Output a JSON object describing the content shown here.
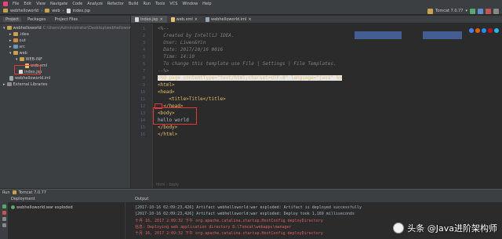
{
  "menubar": {
    "items": [
      "File",
      "Edit",
      "View",
      "Navigate",
      "Code",
      "Analyze",
      "Refactor",
      "Build",
      "Run",
      "Tools",
      "VCS",
      "Window",
      "Help"
    ]
  },
  "navbar": {
    "project": "webhelloworld",
    "folder": "web",
    "file": "index.jsp"
  },
  "run_config": {
    "label": "Tomcat 7.0.77"
  },
  "project_panel": {
    "tabs": [
      "Project",
      "Packages",
      "Project Files"
    ],
    "tree": [
      {
        "label": "webhelloworld",
        "path": "C:\\Users\\Administrator\\Desktop\\webhelloworld"
      },
      {
        "label": ".idea"
      },
      {
        "label": "out"
      },
      {
        "label": "src"
      },
      {
        "label": "web"
      },
      {
        "label": "WEB-INF"
      },
      {
        "label": "web.xml"
      },
      {
        "label": "index.jsp"
      },
      {
        "label": "webhelloworld.iml"
      },
      {
        "label": "External Libraries"
      }
    ]
  },
  "editor": {
    "tabs": [
      "index.jsp",
      "web.xml",
      "webhelloworld.iml"
    ],
    "active_tab": "index.jsp",
    "lines": [
      {
        "n": "1",
        "text": "<%--"
      },
      {
        "n": "2",
        "text": "  Created by IntelliJ IDEA."
      },
      {
        "n": "3",
        "text": "  User: Liwen&Yin"
      },
      {
        "n": "4",
        "text": "  Date: 2017/10/16 0016"
      },
      {
        "n": "5",
        "text": "  Time: 14:10"
      },
      {
        "n": "6",
        "text": "  To change this template use File | Settings | File Templates."
      },
      {
        "n": "7",
        "text": "--%>"
      },
      {
        "n": "8",
        "text": "<%@ page contentType=\"text/html;charset=UTF-8\" language=\"java\" %>"
      },
      {
        "n": "9",
        "text": "<html>"
      },
      {
        "n": "10",
        "text": "<head>"
      },
      {
        "n": "11",
        "text": "    <title>Title</title>"
      },
      {
        "n": "12",
        "text": "  </head>"
      },
      {
        "n": "13",
        "text": "<body>"
      },
      {
        "n": "14",
        "text": "hello world"
      },
      {
        "n": "15",
        "text": "</body>"
      },
      {
        "n": "16",
        "text": "</html>"
      }
    ],
    "breadcrumb": "html › body"
  },
  "run_panel": {
    "title": "Run",
    "config": "Tomcat 7.0.77",
    "deployment_label": "Deployment",
    "output_label": "Output",
    "deployment_item": "webhelloworld:war exploded",
    "output_lines": [
      {
        "text": "[2017-10-16 02:09:23,426] Artifact webhelloworld:war exploded: Artifact is deployed successfully",
        "color": "gray"
      },
      {
        "text": "[2017-10-16 02:09:23,426] Artifact webhelloworld:war exploded: Deploy took 1,169 milliseconds",
        "color": "gray"
      },
      {
        "text": "十月 16, 2017 2:09:32 下午 org.apache.catalina.startup.HostConfig deployDirectory",
        "color": "red"
      },
      {
        "text": "信息: Deploying web application directory D:\\Tomcat\\webapps\\manager",
        "color": "red"
      },
      {
        "text": "十月 16, 2017 2:09:32 下午 org.apache.catalina.startup.HostConfig deployDirectory",
        "color": "red"
      }
    ]
  },
  "watermark": {
    "text": "头条 @Java进阶架构师"
  },
  "colors": {
    "background": "#2b2b2b",
    "panel": "#3c3f41",
    "highlight_box": "#e53935"
  }
}
